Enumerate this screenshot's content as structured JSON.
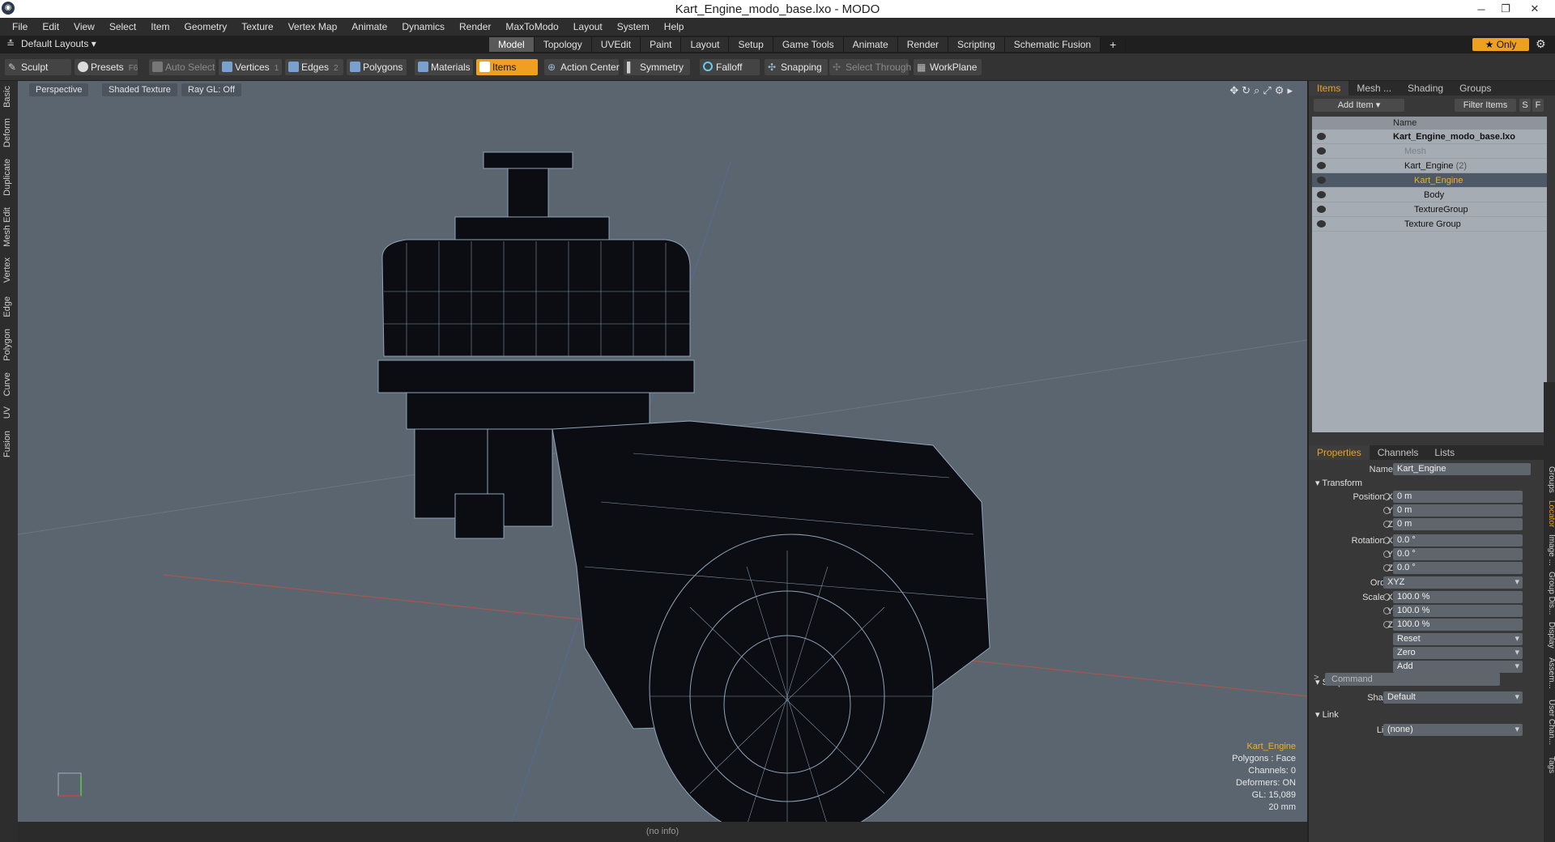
{
  "window": {
    "title": "Kart_Engine_modo_base.lxo - MODO",
    "app_icon": "modo-logo-icon"
  },
  "menu": [
    "File",
    "Edit",
    "View",
    "Select",
    "Item",
    "Geometry",
    "Texture",
    "Vertex Map",
    "Animate",
    "Dynamics",
    "Render",
    "MaxToModo",
    "Layout",
    "System",
    "Help"
  ],
  "layout": {
    "name": "Default Layouts",
    "only_label": "Only"
  },
  "tabs": [
    "Model",
    "Topology",
    "UVEdit",
    "Paint",
    "Layout",
    "Setup",
    "Game Tools",
    "Animate",
    "Render",
    "Scripting",
    "Schematic Fusion"
  ],
  "toolbar": {
    "sculpt": "Sculpt",
    "presets": "Presets",
    "presets_key": "F6",
    "auto_select": "Auto Select",
    "vertices": "Vertices",
    "vertices_key": "1",
    "edges": "Edges",
    "edges_key": "2",
    "polygons": "Polygons",
    "materials": "Materials",
    "items": "Items",
    "action_center": "Action Center",
    "symmetry": "Symmetry",
    "falloff": "Falloff",
    "snapping": "Snapping",
    "select_through": "Select Through",
    "workplane": "WorkPlane"
  },
  "left_tabs": [
    "Basic",
    "Deform",
    "Duplicate",
    "Mesh Edit",
    "Vertex",
    "Edge",
    "Polygon",
    "Curve",
    "UV",
    "Fusion"
  ],
  "viewport": {
    "view": "Perspective",
    "shading": "Shaded Texture",
    "raygl": "Ray GL: Off",
    "info": {
      "item": "Kart_Engine",
      "polygons": "Polygons : Face",
      "channels": "Channels: 0",
      "deformers": "Deformers: ON",
      "gl": "GL: 15,089",
      "scale": "20 mm"
    },
    "status": "(no info)"
  },
  "items_panel": {
    "tabs": [
      "Items",
      "Mesh ...",
      "Shading",
      "Groups"
    ],
    "add_item": "Add Item",
    "filter_items": "Filter Items",
    "s": "S",
    "f": "F",
    "col_name": "Name",
    "tree": [
      {
        "label": "Kart_Engine_modo_base.lxo",
        "level": 0,
        "bold": true
      },
      {
        "label": "Mesh",
        "level": 1,
        "dim": true
      },
      {
        "label": "Kart_Engine",
        "level": 1,
        "count": "(2)"
      },
      {
        "label": "Kart_Engine",
        "level": 2,
        "selected": true
      },
      {
        "label": "Body",
        "level": 3
      },
      {
        "label": "TextureGroup",
        "level": 2
      },
      {
        "label": "Texture Group",
        "level": 1
      }
    ]
  },
  "properties": {
    "tabs": [
      "Properties",
      "Channels",
      "Lists"
    ],
    "name_label": "Name",
    "name_value": "Kart_Engine",
    "transform": "Transform",
    "position_x": "Position X",
    "y": "Y",
    "z": "Z",
    "rotation_x": "Rotation X",
    "order": "Order",
    "scale_x": "Scale X",
    "pos": [
      "0 m",
      "0 m",
      "0 m"
    ],
    "rot": [
      "0.0 °",
      "0.0 °",
      "0.0 °"
    ],
    "order_value": "XYZ",
    "scale": [
      "100.0 %",
      "100.0 %",
      "100.0 %"
    ],
    "reset": "Reset",
    "zero": "Zero",
    "add": "Add",
    "shape_section": "Shape",
    "shape_label": "Shape",
    "shape_value": "Default",
    "link_section": "Link",
    "link_label": "Link",
    "link_value": "(none)",
    "command_placeholder": "Command"
  },
  "side_tabs": [
    "Groups",
    "Locator",
    "Image ...",
    "Group Dis...",
    "Display",
    "Assem...",
    "User Chan...",
    "Tags"
  ]
}
